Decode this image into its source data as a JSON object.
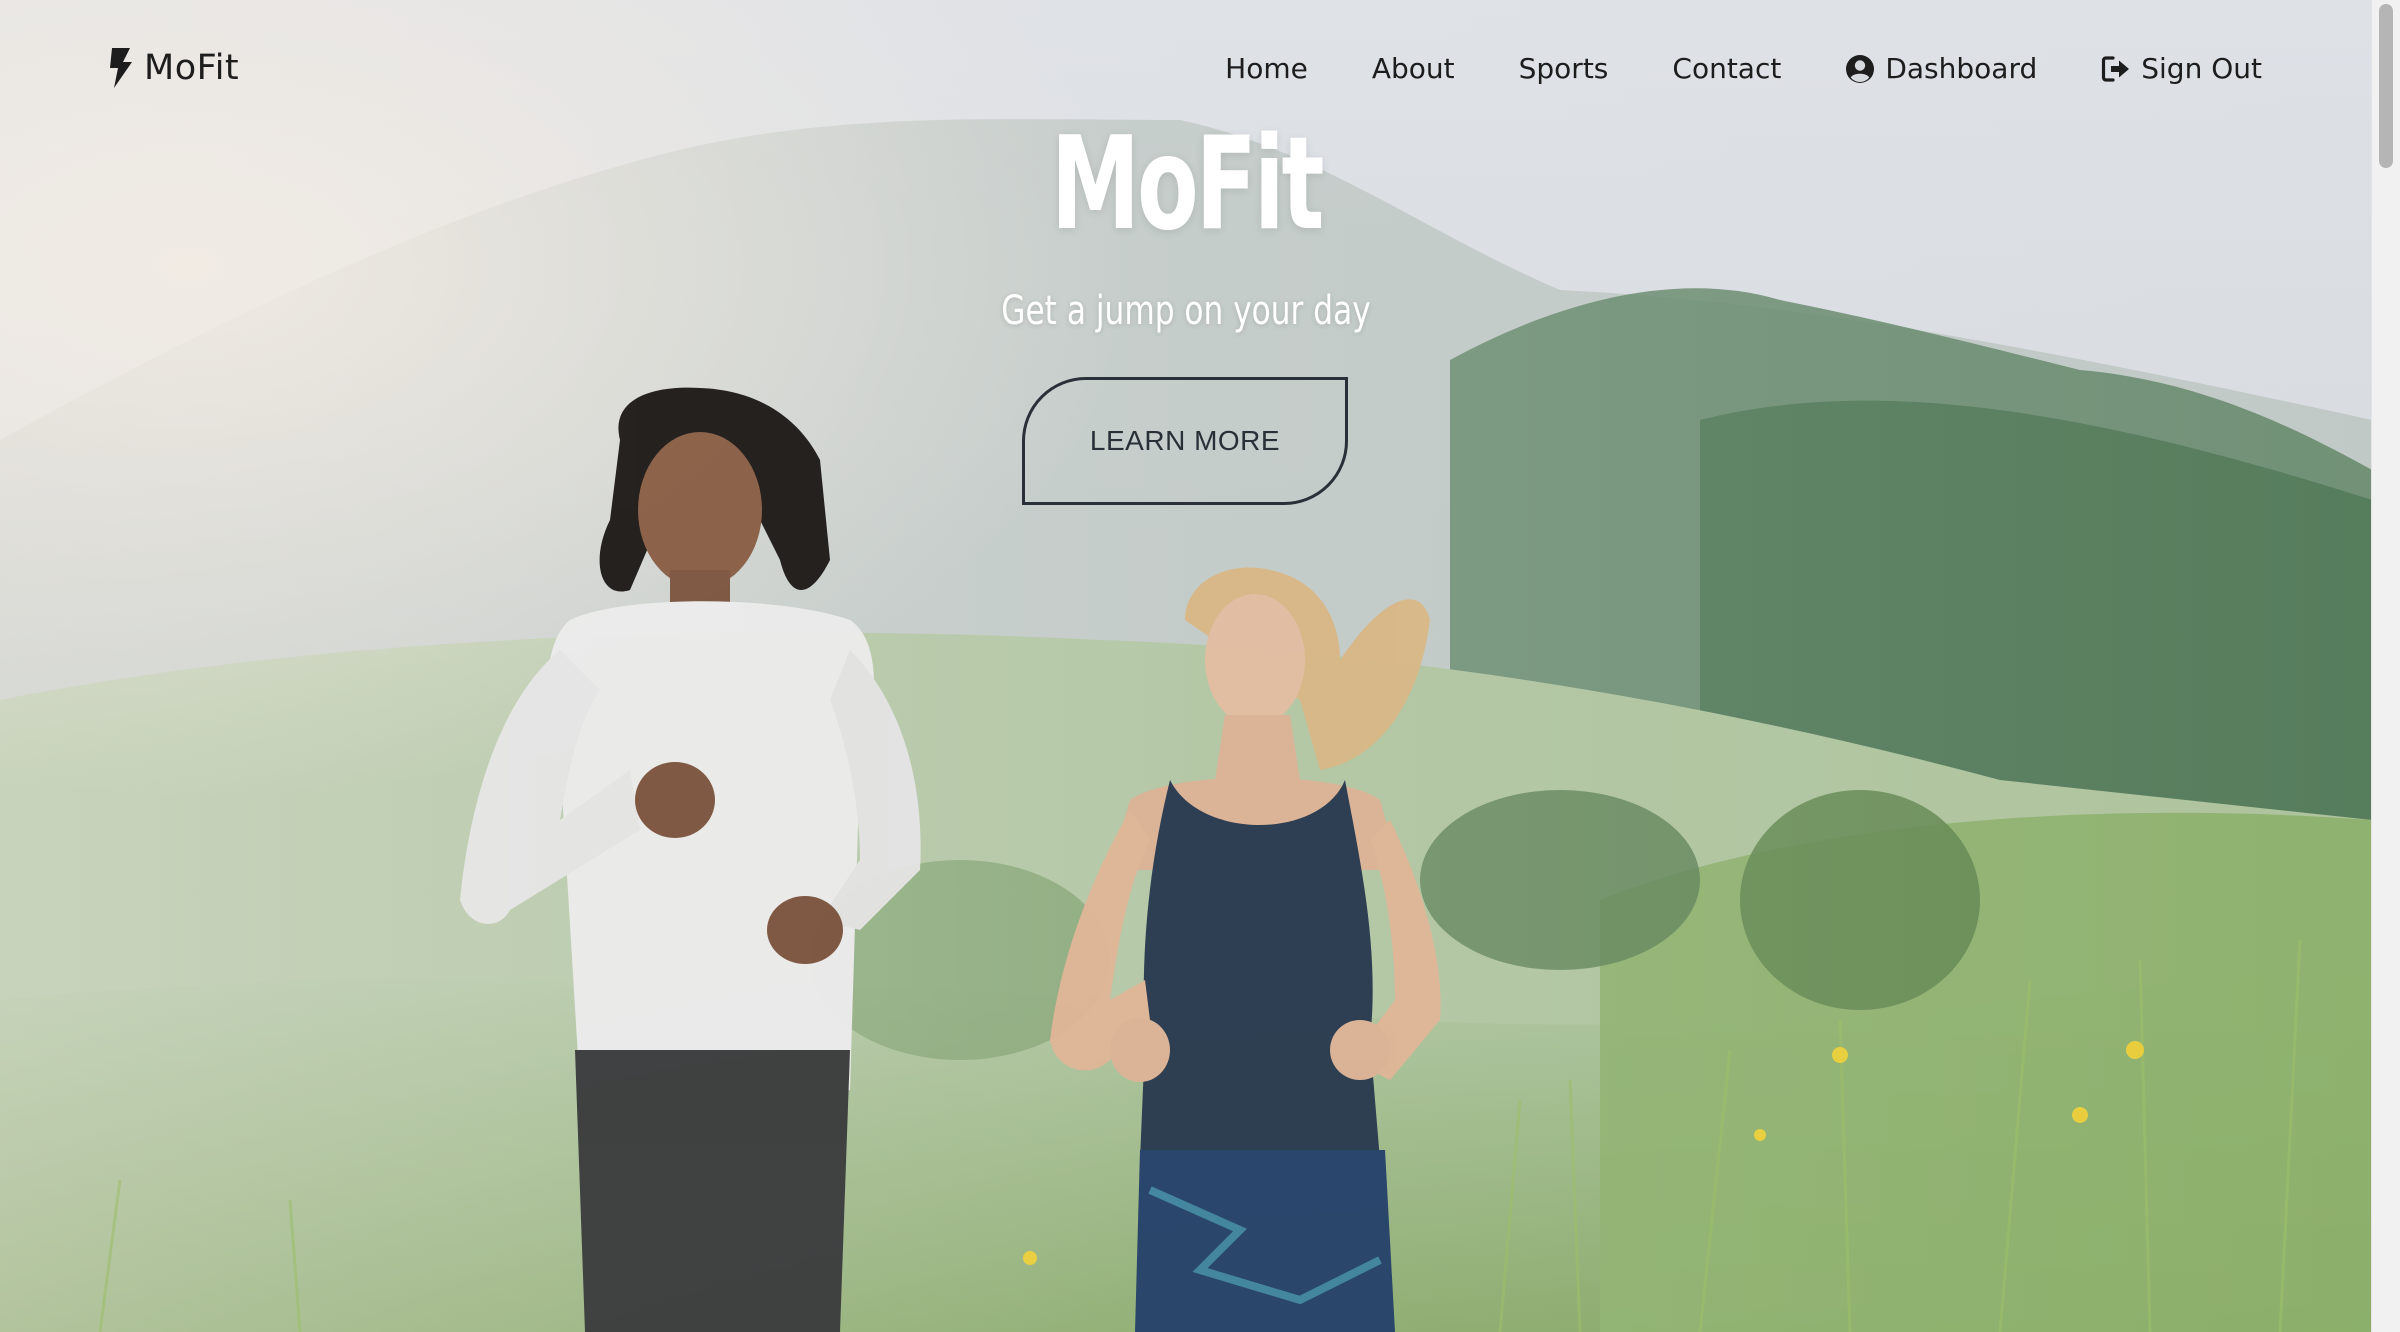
{
  "brand": {
    "name": "MoFit",
    "icon": "bolt-icon"
  },
  "nav": {
    "items": [
      {
        "label": "Home"
      },
      {
        "label": "About"
      },
      {
        "label": "Sports"
      },
      {
        "label": "Contact"
      },
      {
        "label": "Dashboard",
        "icon": "user-circle-icon"
      },
      {
        "label": "Sign Out",
        "icon": "sign-out-icon"
      }
    ]
  },
  "hero": {
    "title": "MoFit",
    "subtitle": "Get a jump on your day",
    "cta_label": "LEARN MORE",
    "image_subject": "two runners on a grassy hillside in morning fog"
  },
  "colors": {
    "text_dark": "#1d1d1d",
    "button_border": "#2a3037",
    "hero_text": "#ffffff",
    "scrollbar_thumb": "#b5b5b5"
  }
}
